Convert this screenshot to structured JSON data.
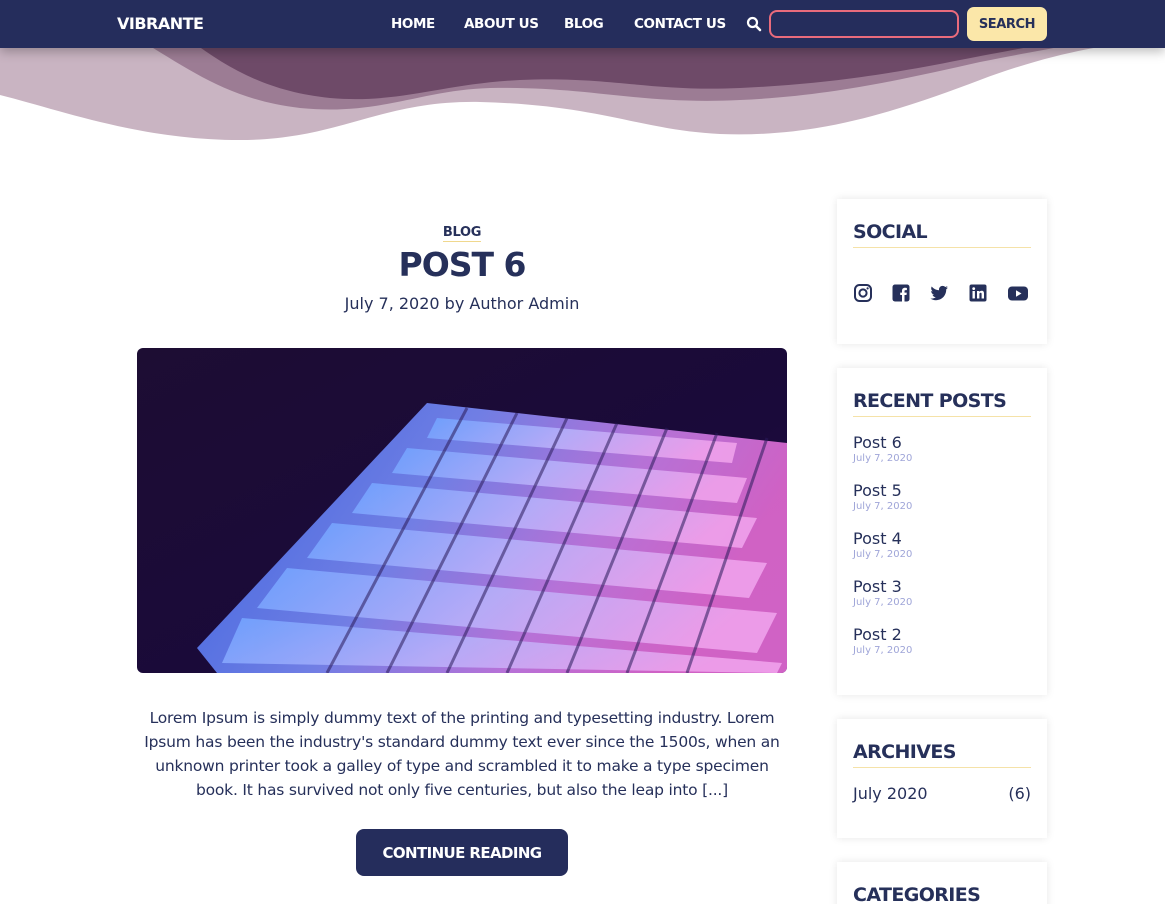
{
  "header": {
    "brand": "VIBRANTE",
    "nav": [
      "HOME",
      "ABOUT US",
      "BLOG",
      "CONTACT US"
    ],
    "search_placeholder": "",
    "search_button": "SEARCH"
  },
  "post": {
    "category": "BLOG",
    "title": "POST 6",
    "meta": "July 7, 2020 by Author Admin",
    "excerpt": "Lorem Ipsum is simply dummy text of the printing and typesetting industry. Lorem Ipsum has been the industry's standard dummy text ever since the 1500s, when an unknown printer took a galley of type and scrambled it to make a type specimen book. It has survived not only five centuries, but also the leap into [...]",
    "continue_label": "CONTINUE READING"
  },
  "sidebar": {
    "social": {
      "title": "SOCIAL",
      "icons": [
        "instagram-icon",
        "facebook-icon",
        "twitter-icon",
        "linkedin-icon",
        "youtube-icon"
      ]
    },
    "recent_posts": {
      "title": "RECENT POSTS",
      "items": [
        {
          "title": "Post 6",
          "date": "July 7, 2020"
        },
        {
          "title": "Post 5",
          "date": "July 7, 2020"
        },
        {
          "title": "Post 4",
          "date": "July 7, 2020"
        },
        {
          "title": "Post 3",
          "date": "July 7, 2020"
        },
        {
          "title": "Post 2",
          "date": "July 7, 2020"
        }
      ]
    },
    "archives": {
      "title": "ARCHIVES",
      "items": [
        {
          "label": "July 2020",
          "count": "(6)"
        }
      ]
    },
    "categories": {
      "title": "CATEGORIES"
    }
  },
  "colors": {
    "navy": "#252d5c",
    "accent_yellow": "#fbe7a9",
    "search_border": "#e96b7c",
    "wave_dark": "#6e4a68",
    "wave_light": "#c9b4c2",
    "date_muted": "#9fa5d8"
  }
}
